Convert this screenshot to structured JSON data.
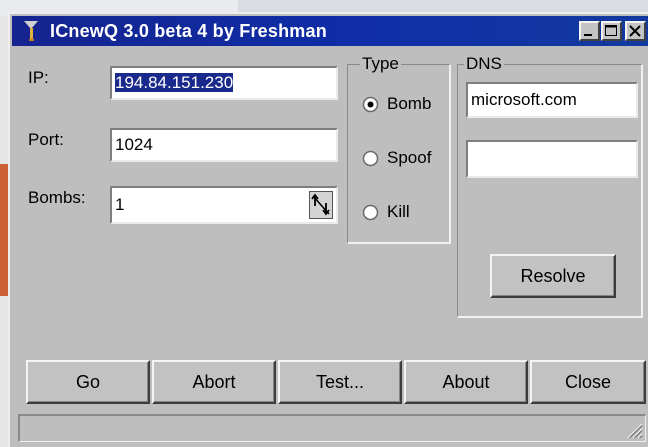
{
  "window": {
    "title": "ICnewQ 3.0 beta 4 by Freshman",
    "controls": [
      "minimize",
      "maximize",
      "close"
    ]
  },
  "form": {
    "ip_label": "IP:",
    "ip_value": "194.84.151.230",
    "port_label": "Port:",
    "port_value": "1024",
    "bombs_label": "Bombs:",
    "bombs_value": "1"
  },
  "type_group": {
    "title": "Type",
    "options": [
      {
        "label": "Bomb",
        "selected": true
      },
      {
        "label": "Spoof",
        "selected": false
      },
      {
        "label": "Kill",
        "selected": false
      }
    ]
  },
  "dns_group": {
    "title": "DNS",
    "host_value": "microsoft.com",
    "result_value": "",
    "resolve_label": "Resolve"
  },
  "buttons": {
    "go": "Go",
    "abort": "Abort",
    "test": "Test...",
    "about": "About",
    "close": "Close"
  },
  "colors": {
    "titlebar": "#15248f",
    "window_face": "#bebebe",
    "backdrop": "#cd5f34",
    "selection": "#1a2a8c"
  },
  "icons": [
    "app-icon",
    "minimize-icon",
    "maximize-icon",
    "close-icon",
    "spin-arrows-icon",
    "resize-grip-icon"
  ]
}
